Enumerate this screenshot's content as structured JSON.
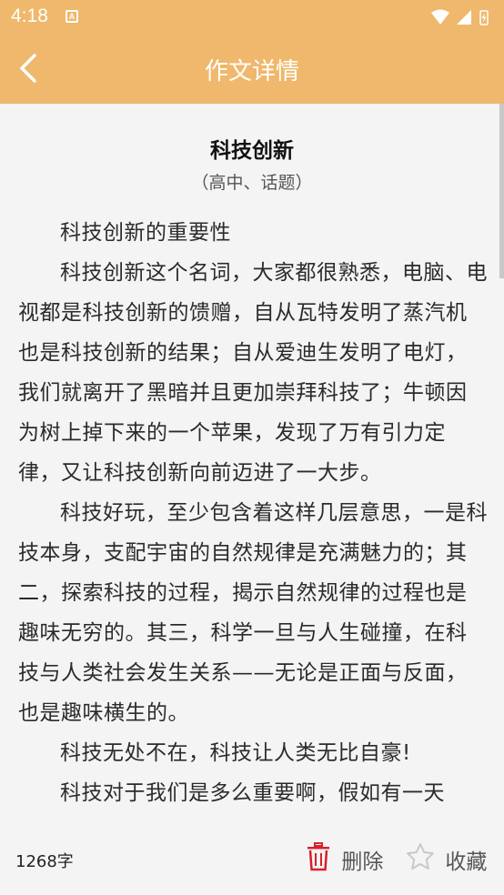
{
  "status_bar": {
    "time": "4:18",
    "notification_letter": "A"
  },
  "header": {
    "title": "作文详情",
    "background": "#efb86c"
  },
  "article": {
    "title": "科技创新",
    "subtitle": "（高中、话题）",
    "paragraphs": [
      "科技创新的重要性",
      "科技创新这个名词，大家都很熟悉，电脑、电视都是科技创新的馈赠，自从瓦特发明了蒸汽机也是科技创新的结果；自从爱迪生发明了电灯，我们就离开了黑暗并且更加崇拜科技了；牛顿因为树上掉下来的一个苹果，发现了万有引力定律，又让科技创新向前迈进了一大步。",
      "科技好玩，至少包含着这样几层意思，一是科技本身，支配宇宙的自然规律是充满魅力的；其二，探索科技的过程，揭示自然规律的过程也是趣味无穷的。其三，科学一旦与人生碰撞，在科技与人类社会发生关系——无论是正面与反面，也是趣味横生的。",
      "科技无处不在，科技让人类无比自豪!",
      "科技对于我们是多么重要啊，假如有一天"
    ]
  },
  "bottom_bar": {
    "word_count": "1268字",
    "delete_label": "删除",
    "favorite_label": "收藏",
    "delete_color": "#d9202a"
  }
}
